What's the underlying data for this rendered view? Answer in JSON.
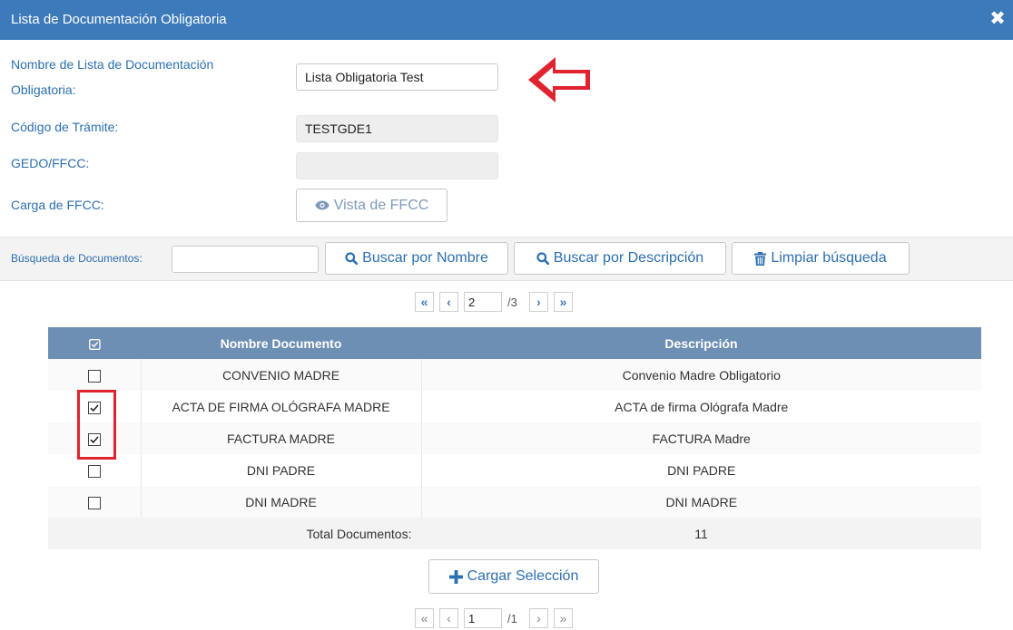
{
  "window": {
    "title": "Lista de Documentación Obligatoria",
    "close_glyph": "✖"
  },
  "form": {
    "name_label_line1": "Nombre de Lista de Documentación",
    "name_label_line2": "Obligatoria:",
    "name_value": "Lista Obligatoria Test",
    "code_label": "Código de Trámite:",
    "code_value": "TESTGDE1",
    "gedo_label": "GEDO/FFCC:",
    "gedo_value": "",
    "ffcc_label": "Carga de FFCC:",
    "ffcc_button": "Vista de FFCC"
  },
  "search": {
    "label": "Búsqueda de Documentos:",
    "value": "",
    "by_name_button": "Buscar por Nombre",
    "by_desc_button": "Buscar por Descripción",
    "clear_button": "Limpiar búsqueda"
  },
  "top_pager": {
    "first": "«",
    "prev": "‹",
    "current_page": "2",
    "total": "/3",
    "next": "›",
    "last": "»"
  },
  "table": {
    "columns": [
      "Nombre Documento",
      "Descripción"
    ],
    "rows": [
      {
        "name": "CONVENIO MADRE",
        "description": "Convenio Madre Obligatorio",
        "checked": false
      },
      {
        "name": "ACTA DE FIRMA OLÓGRAFA MADRE",
        "description": "ACTA de firma Ológrafa Madre",
        "checked": true
      },
      {
        "name": "FACTURA MADRE",
        "description": "FACTURA Madre",
        "checked": true
      },
      {
        "name": "DNI PADRE",
        "description": "DNI PADRE",
        "checked": false
      },
      {
        "name": "DNI MADRE",
        "description": "DNI MADRE",
        "checked": false
      }
    ],
    "total_label": "Total Documentos:",
    "total_value": "11"
  },
  "load_button": "Cargar Selección",
  "bottom_pager": {
    "first": "«",
    "prev": "‹",
    "current_page": "1",
    "total": "/1",
    "next": "›",
    "last": "»"
  },
  "colors": {
    "title_bar": "#3c7ab9",
    "label_blue": "#2c6fb0",
    "table_header": "#6d8fb3",
    "annotation_red": "#e0232f"
  },
  "icons": {
    "close": "close-icon",
    "ffcc": "eye-icon",
    "search": "search-icon",
    "clear": "trash-icon",
    "load": "plus-icon",
    "select_all": "checkbox-icon",
    "annotation": "red-arrow-left"
  }
}
